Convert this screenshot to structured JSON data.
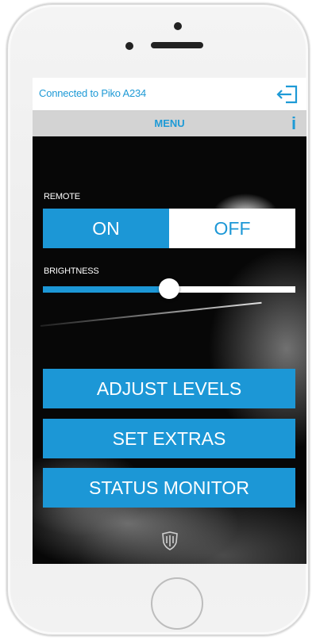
{
  "status_bar": {
    "connection_text": "Connected to Piko A234"
  },
  "nav": {
    "title": "MENU",
    "info_label": "i"
  },
  "remote": {
    "label": "REMOTE",
    "on_label": "ON",
    "off_label": "OFF",
    "selected": "ON"
  },
  "brightness": {
    "label": "BRIGHTNESS",
    "value_fraction": 0.5
  },
  "menu": {
    "adjust_levels_label": "ADJUST LEVELS",
    "set_extras_label": "SET EXTRAS",
    "status_monitor_label": "STATUS MONITOR"
  },
  "colors": {
    "accent": "#1c97d6",
    "nav_bg": "#d3d3d3",
    "status_bg": "#ffffff"
  },
  "icons": {
    "exit": "exit-arrow-icon",
    "info": "info-icon",
    "logo": "shield-logo-icon"
  }
}
